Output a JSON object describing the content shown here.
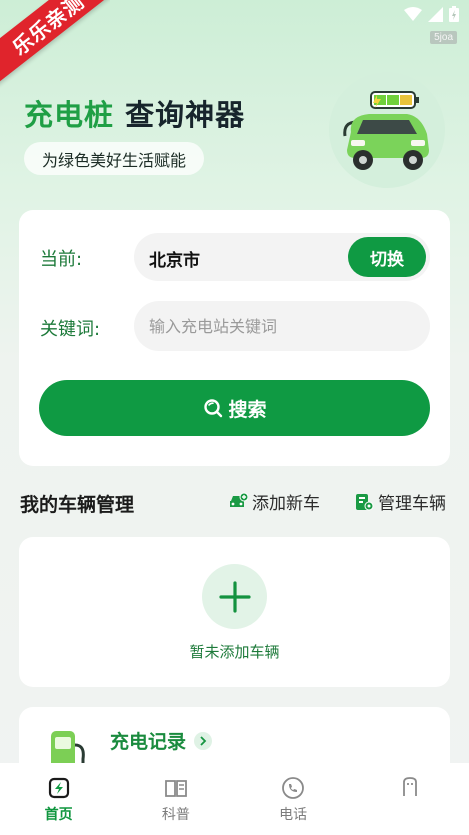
{
  "ribbon": {
    "text": "乐乐亲测"
  },
  "status": {
    "tag": "5joa"
  },
  "hero": {
    "title_green": "充电桩",
    "title_dark": "查询神器",
    "subtitle": "为绿色美好生活赋能"
  },
  "search": {
    "current_label": "当前:",
    "city": "北京市",
    "switch_label": "切换",
    "keyword_label": "关键词:",
    "keyword_placeholder": "输入充电站关键词",
    "keyword_value": "",
    "search_label": "搜索"
  },
  "vehicles": {
    "title": "我的车辆管理",
    "add_label": "添加新车",
    "manage_label": "管理车辆",
    "empty_text": "暂未添加车辆"
  },
  "records": {
    "title": "充电记录"
  },
  "tabs": [
    {
      "label": "首页",
      "icon": "home-bolt-icon",
      "active": true
    },
    {
      "label": "科普",
      "icon": "book-icon",
      "active": false
    },
    {
      "label": "电话",
      "icon": "phone-icon",
      "active": false
    },
    {
      "label": "",
      "icon": "charger-icon",
      "active": false
    }
  ],
  "colors": {
    "accent": "#0f9a43",
    "ribbon": "#e0242c",
    "label_green": "#1d7a3a"
  }
}
